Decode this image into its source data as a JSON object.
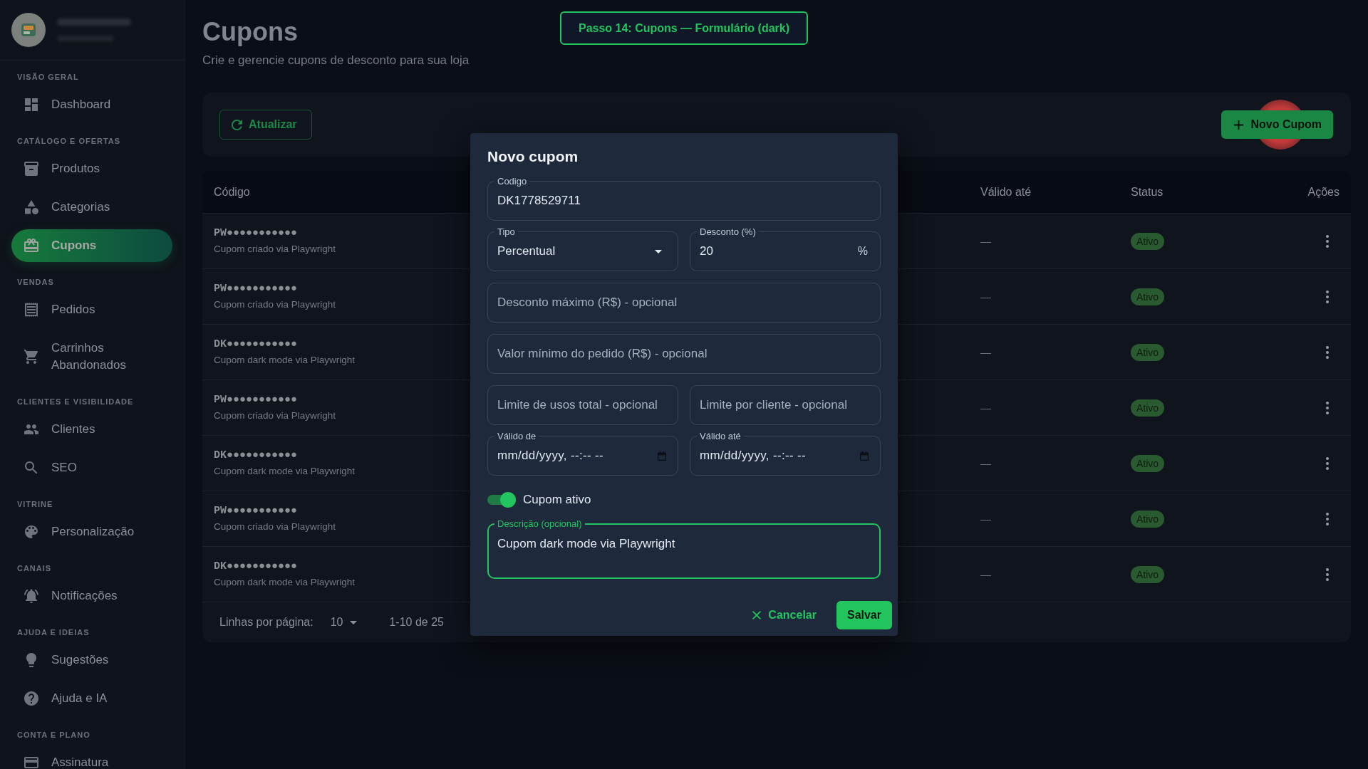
{
  "sidebar": {
    "sections": [
      {
        "title": "VISÃO GERAL",
        "items": [
          {
            "label": "Dashboard",
            "selected": false
          }
        ]
      },
      {
        "title": "CATÁLOGO E OFERTAS",
        "items": [
          {
            "label": "Produtos",
            "selected": false
          },
          {
            "label": "Categorias",
            "selected": false
          },
          {
            "label": "Cupons",
            "selected": true
          }
        ]
      },
      {
        "title": "VENDAS",
        "items": [
          {
            "label": "Pedidos",
            "selected": false
          },
          {
            "label": "Carrinhos Abandonados",
            "selected": false
          }
        ]
      },
      {
        "title": "CLIENTES E VISIBILIDADE",
        "items": [
          {
            "label": "Clientes",
            "selected": false
          },
          {
            "label": "SEO",
            "selected": false
          }
        ]
      },
      {
        "title": "VITRINE",
        "items": [
          {
            "label": "Personalização",
            "selected": false
          }
        ]
      },
      {
        "title": "CANAIS",
        "items": [
          {
            "label": "Notificações",
            "selected": false
          }
        ]
      },
      {
        "title": "AJUDA E IDEIAS",
        "items": [
          {
            "label": "Sugestões",
            "selected": false
          },
          {
            "label": "Ajuda e IA",
            "selected": false
          }
        ]
      },
      {
        "title": "CONTA E PLANO",
        "items": [
          {
            "label": "Assinatura",
            "selected": false
          }
        ]
      }
    ]
  },
  "step_banner": "Passo 14: Cupons — Formulário (dark)",
  "header": {
    "title": "Cupons",
    "subtitle": "Crie e gerencie cupons de desconto para sua loja"
  },
  "toolbar": {
    "refresh_button": "Atualizar",
    "new_button": "Novo Cupom"
  },
  "table": {
    "columns": [
      "Código",
      "Válido até",
      "Status",
      "Ações"
    ],
    "rows": [
      {
        "code": "PW●●●●●●●●●●●",
        "description": "Cupom criado via Playwright",
        "valid_until": "—",
        "status": "Ativo"
      },
      {
        "code": "PW●●●●●●●●●●●",
        "description": "Cupom criado via Playwright",
        "valid_until": "—",
        "status": "Ativo"
      },
      {
        "code": "DK●●●●●●●●●●●",
        "description": "Cupom dark mode via Playwright",
        "valid_until": "—",
        "status": "Ativo"
      },
      {
        "code": "PW●●●●●●●●●●●",
        "description": "Cupom criado via Playwright",
        "valid_until": "—",
        "status": "Ativo"
      },
      {
        "code": "DK●●●●●●●●●●●",
        "description": "Cupom dark mode via Playwright",
        "valid_until": "—",
        "status": "Ativo"
      },
      {
        "code": "PW●●●●●●●●●●●",
        "description": "Cupom criado via Playwright",
        "valid_until": "—",
        "status": "Ativo"
      },
      {
        "code": "DK●●●●●●●●●●●",
        "description": "Cupom dark mode via Playwright",
        "valid_until": "—",
        "status": "Ativo"
      }
    ],
    "footer": {
      "rows_per_page_label": "Linhas por página:",
      "rows_per_page": "10",
      "range": "1-10 de 25"
    }
  },
  "dialog": {
    "title": "Novo cupom",
    "rows": [
      [
        {
          "kind": "text",
          "label": "Codigo",
          "value": "DK1778529711",
          "focused": false
        }
      ],
      [
        {
          "kind": "select",
          "label": "Tipo",
          "value": "Percentual",
          "focused": false
        },
        {
          "kind": "number",
          "label": "Desconto (%)",
          "value": "20",
          "suffix": "%",
          "focused": false
        }
      ],
      [
        {
          "kind": "text",
          "placeholder": "Desconto máximo (R$) - opcional",
          "focused": false
        }
      ],
      [
        {
          "kind": "text",
          "placeholder": "Valor mínimo do pedido (R$) - opcional",
          "focused": false
        }
      ],
      [
        {
          "kind": "text",
          "placeholder": "Limite de usos total - opcional",
          "focused": false
        },
        {
          "kind": "text",
          "placeholder": "Limite por cliente - opcional",
          "focused": false
        }
      ],
      [
        {
          "kind": "datetime",
          "label": "Válido de",
          "value": "mm/dd/yyyy, --:-- --",
          "focused": false
        },
        {
          "kind": "datetime",
          "label": "Válido até",
          "value": "mm/dd/yyyy, --:-- --",
          "focused": false
        }
      ],
      [
        {
          "kind": "toggle",
          "label": "Cupom ativo",
          "on": true
        }
      ],
      [
        {
          "kind": "textarea",
          "label": "Descrição (opcional)",
          "value": "Cupom dark mode via Playwright",
          "focused": true
        }
      ]
    ],
    "actions": [
      {
        "kind": "text",
        "label": "Cancelar"
      },
      {
        "kind": "filled",
        "label": "Salvar"
      }
    ]
  }
}
